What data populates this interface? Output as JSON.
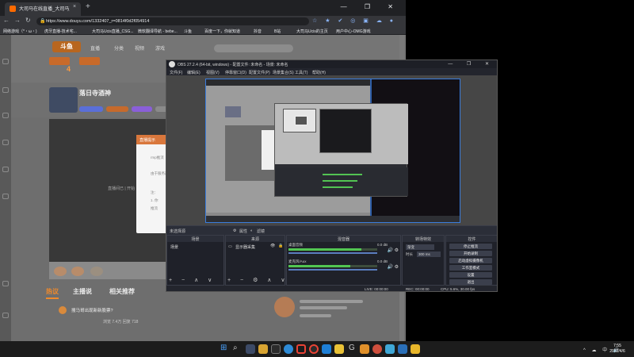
{
  "browser": {
    "tab_title": "大司马在线直播_大司马直播_斗鱼直播",
    "tab_close": "×",
    "new_tab": "+",
    "win_controls": "— ❐ ✕",
    "url": "https://www.douyu.com/1332407_r=0814f0d2f054914",
    "ext_icons": "☆ ★ ✔ ◎ ▣ ☁ ●",
    "bookmarks": [
      "网络游戏（*・ω・)",
      "虎牙直播-技术宅...",
      "大司马Ucis直播_CSG...",
      "微软翻译导航 - bebe...",
      "斗鱼",
      "百度一下，你就知道",
      "抖音",
      "B站",
      "大司马Ucis的主页",
      "用户中心-OMG游戏"
    ],
    "page": {
      "logo": "斗鱼",
      "big_num": "4",
      "nav": [
        "直播",
        "分类",
        "视频",
        "游戏"
      ],
      "streamer_name": "落日寺酒神",
      "live_panel_title": "直播提示",
      "live_lines": [
        "rmp推流",
        "由于服务器...",
        "注：",
        "1. 你",
        "推流"
      ],
      "video_caption": "直播间已 | 开始",
      "tabs": [
        "热议",
        "主播说",
        "相关推荐"
      ],
      "feed_text": "搜马哥出现新新股票?",
      "feed_sub": "浏览 7.4万  回复 718"
    }
  },
  "obs": {
    "title": "OBS 27.2.4 (64-bit, windows) - 配置文件: 未命名 - 场景: 未命名",
    "menu": [
      "文件(F)",
      "编辑(E)",
      "视图(V)",
      "停靠窗口(D)",
      "配置文件(P)",
      "场景集合(S)",
      "工具(T)",
      "帮助(H)"
    ],
    "toolbar": {
      "source_label": "未选择源",
      "props": "属性",
      "filters": "滤镜"
    },
    "docks": {
      "scenes": {
        "title": "场景",
        "items": [
          "场景"
        ]
      },
      "sources": {
        "title": "来源",
        "items": [
          "显示器采集"
        ]
      },
      "mixer": {
        "title": "混音器",
        "tracks": [
          {
            "name": "桌面音频",
            "db": "0.0 dB",
            "level": 0.82
          },
          {
            "name": "麦克风/Aux",
            "db": "0.0 dB",
            "level": 0.7
          }
        ]
      },
      "transitions": {
        "title": "转场特效",
        "type": "渐变",
        "duration_label": "时长",
        "duration": "300 ms"
      },
      "controls": {
        "title": "控件",
        "buttons": [
          "停止推流",
          "开始录制",
          "启动虚拟摄像机",
          "工作室模式",
          "设置",
          "退出"
        ]
      }
    },
    "status": {
      "live": "LIVE: 00:00:00",
      "rec": "REC: 00:00:00",
      "cpu": "CPU: 5.6%, 30.00 fps"
    }
  },
  "taskbar": {
    "tray": "^ ☁ 中 🔊",
    "time": "7:55",
    "date": "2022/4/6"
  }
}
